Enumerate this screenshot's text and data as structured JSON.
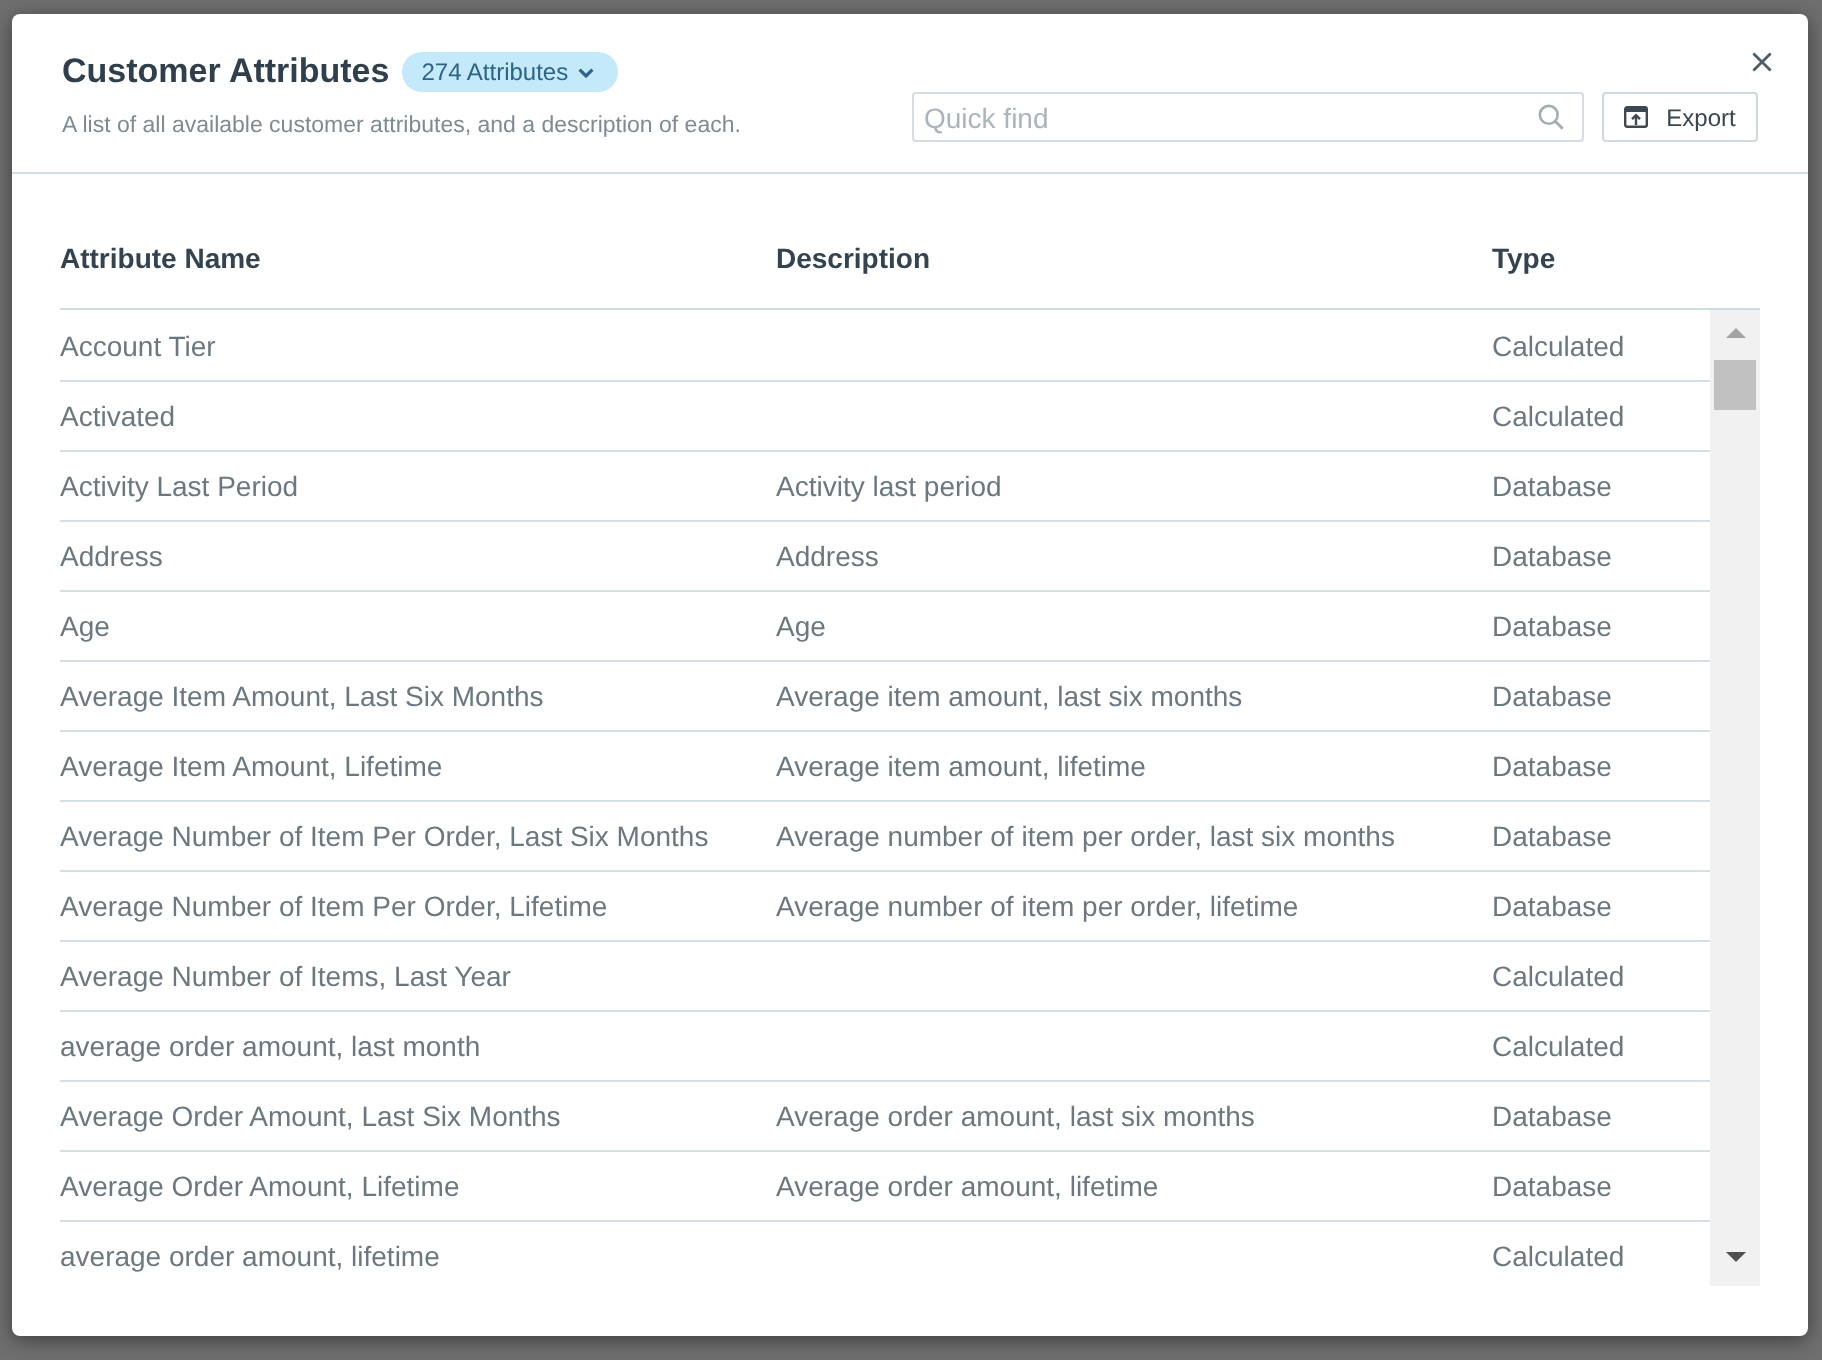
{
  "dialog": {
    "title": "Customer Attributes",
    "count_badge": "274 Attributes",
    "subtitle": "A list of all available customer attributes, and a description of each.",
    "search": {
      "placeholder": "Quick find"
    },
    "export_button": "Export"
  },
  "table": {
    "columns": [
      "Attribute Name",
      "Description",
      "Type"
    ],
    "rows": [
      {
        "name": "Account Tier",
        "type": "Calculated"
      },
      {
        "name": "Activated",
        "type": "Calculated"
      },
      {
        "name": "Activity Last Period",
        "description": "Activity last period",
        "type": "Database"
      },
      {
        "name": "Address",
        "description": "Address",
        "type": "Database"
      },
      {
        "name": "Age",
        "description": "Age",
        "type": "Database"
      },
      {
        "name": "Average Item Amount, Last Six Months",
        "description": "Average item amount, last six months",
        "type": "Database"
      },
      {
        "name": "Average Item Amount, Lifetime",
        "description": "Average item amount, lifetime",
        "type": "Database"
      },
      {
        "name": "Average Number of Item Per Order, Last Six Months",
        "description": "Average number of item per order, last six months",
        "type": "Database"
      },
      {
        "name": "Average Number of Item Per Order, Lifetime",
        "description": "Average number of item per order, lifetime",
        "type": "Database"
      },
      {
        "name": "Average Number of Items, Last Year",
        "type": "Calculated"
      },
      {
        "name": "average order amount, last month",
        "type": "Calculated"
      },
      {
        "name": "Average Order Amount, Last Six Months",
        "description": "Average order amount, last six months",
        "type": "Database"
      },
      {
        "name": "Average Order Amount, Lifetime",
        "description": "Average order amount, lifetime",
        "type": "Database"
      },
      {
        "name": "average order amount, lifetime",
        "type": "Calculated"
      }
    ]
  }
}
